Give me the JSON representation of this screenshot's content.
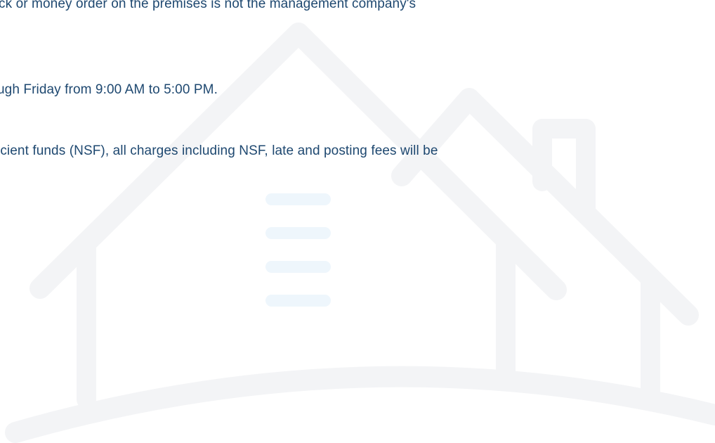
{
  "colors": {
    "text": "#1e4870",
    "watermark_stroke": "#f3f4f6",
    "watermark_bars": "#eef6fc",
    "background": "#ffffff"
  },
  "content": {
    "lines": [
      "ck or money order on the premises is not the management company's",
      "ugh Friday from 9:00 AM to 5:00 PM.",
      "icient funds (NSF), all charges including NSF, late and posting fees will be"
    ]
  },
  "background": {
    "icon": "house-outline-icon"
  }
}
